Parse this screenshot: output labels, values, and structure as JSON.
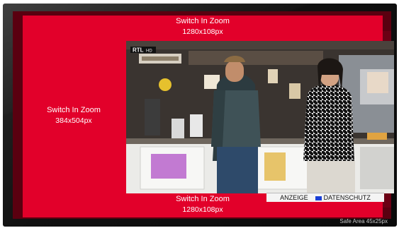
{
  "zones": {
    "top": {
      "title": "Switch In Zoom",
      "size": "1280x108px"
    },
    "left": {
      "title": "Switch In Zoom",
      "size": "384x504px"
    },
    "bottom": {
      "title": "Switch In Zoom",
      "size": "1280x108px"
    }
  },
  "broadcast": {
    "channel_logo": "RTL",
    "channel_logo_suffix": "HD",
    "ad_label": "ANZEIGE",
    "privacy_label": "DATENSCHUTZ"
  },
  "safe_area": "Safe Area 45x25px",
  "colors": {
    "zone_red": "#e2002a",
    "zone_dark": "#6b0014",
    "privacy_blue": "#1a3fd6"
  },
  "icons": [
    "privacy-square-icon"
  ]
}
